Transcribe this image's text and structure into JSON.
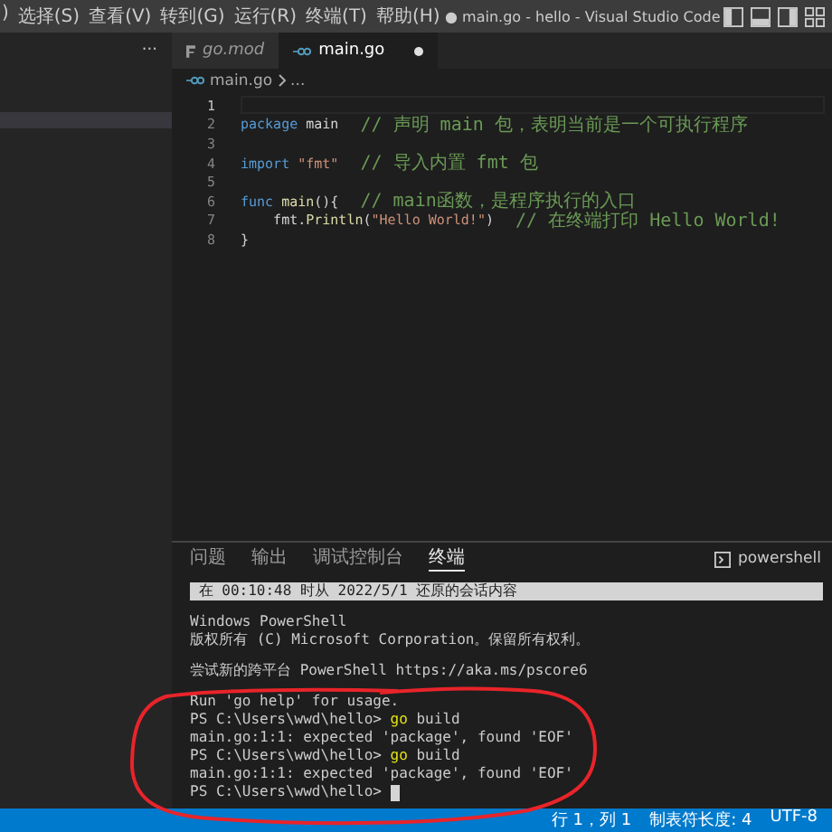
{
  "title_bar": {
    "menu": [
      ")",
      "选择(S)",
      "查看(V)",
      "转到(G)",
      "运行(R)",
      "终端(T)",
      "帮助(H)"
    ],
    "title": "● main.go - hello - Visual Studio Code"
  },
  "sidebar": {
    "more": "···"
  },
  "tabs": [
    {
      "label": "go.mod",
      "selected": false,
      "preview": true
    },
    {
      "label": "main.go",
      "selected": true,
      "preview": false,
      "modified": true
    }
  ],
  "breadcrumb": [
    "main.go",
    "..."
  ],
  "editor": {
    "lines": [
      {
        "number": "1",
        "current": true
      },
      {
        "number": "2",
        "current": false,
        "tokens": [
          {
            "kind": "keyword",
            "text": "package"
          },
          {
            "kind": "plain",
            "text": " main"
          },
          {
            "kind": "comment",
            "text": "  // 声明 main 包，表明当前是一个可执行程序"
          }
        ]
      },
      {
        "number": "3",
        "current": false
      },
      {
        "number": "4",
        "current": false,
        "tokens": [
          {
            "kind": "keyword",
            "text": "import "
          },
          {
            "kind": "string",
            "text": "\"fmt\""
          },
          {
            "kind": "comment",
            "text": "  // 导入内置 fmt 包"
          }
        ]
      },
      {
        "number": "5",
        "current": false
      },
      {
        "number": "6",
        "current": false,
        "tokens": [
          {
            "kind": "keyword",
            "text": "func "
          },
          {
            "kind": "function",
            "text": "main"
          },
          {
            "kind": "plain",
            "text": "(){"
          },
          {
            "kind": "comment",
            "text": "  // main函数，是程序执行的入口"
          }
        ]
      },
      {
        "number": "7",
        "current": false,
        "tokens": [
          {
            "kind": "plain",
            "text": "    fmt."
          },
          {
            "kind": "function",
            "text": "Println"
          },
          {
            "kind": "plain",
            "text": "("
          },
          {
            "kind": "string",
            "text": "\"Hello World!\""
          },
          {
            "kind": "plain",
            "text": ")"
          },
          {
            "kind": "comment",
            "text": "  // 在终端打印 Hello World!"
          }
        ]
      },
      {
        "number": "8",
        "current": false,
        "tokens": [
          {
            "kind": "plain",
            "text": "}"
          }
        ]
      }
    ]
  },
  "panel": {
    "tabs": [
      {
        "label": "问题",
        "selected": false
      },
      {
        "label": "输出",
        "selected": false
      },
      {
        "label": "调试控制台",
        "selected": false
      },
      {
        "label": "终端",
        "selected": true
      }
    ],
    "shell": "powershell",
    "terminal": [
      {
        "kind": "banner",
        "parts": [
          {
            "kind": "plain",
            "text": " 在 00:10:48 时从 2022/5/1 还原的会话内容"
          }
        ]
      },
      {
        "kind": "blank"
      },
      {
        "kind": "text",
        "parts": [
          {
            "kind": "plain",
            "text": "Windows PowerShell"
          }
        ]
      },
      {
        "kind": "text",
        "parts": [
          {
            "kind": "plain",
            "text": "版权所有 (C) Microsoft Corporation。保留所有权利。"
          }
        ]
      },
      {
        "kind": "blank"
      },
      {
        "kind": "text",
        "parts": [
          {
            "kind": "plain",
            "text": "尝试新的跨平台 PowerShell https://aka.ms/pscore6"
          }
        ]
      },
      {
        "kind": "blank"
      },
      {
        "kind": "text",
        "parts": [
          {
            "kind": "plain",
            "text": "Run 'go help' for usage."
          }
        ]
      },
      {
        "kind": "text",
        "parts": [
          {
            "kind": "plain",
            "text": "PS C:\\Users\\wwd\\hello> "
          },
          {
            "kind": "command",
            "text": "go"
          },
          {
            "kind": "plain",
            "text": " build"
          }
        ]
      },
      {
        "kind": "text",
        "parts": [
          {
            "kind": "plain",
            "text": "main.go:1:1: expected 'package', found 'EOF'"
          }
        ]
      },
      {
        "kind": "text",
        "parts": [
          {
            "kind": "plain",
            "text": "PS C:\\Users\\wwd\\hello> "
          },
          {
            "kind": "command",
            "text": "go"
          },
          {
            "kind": "plain",
            "text": " build"
          }
        ]
      },
      {
        "kind": "text",
        "parts": [
          {
            "kind": "plain",
            "text": "main.go:1:1: expected 'package', found 'EOF'"
          }
        ]
      },
      {
        "kind": "text",
        "cursor": true,
        "parts": [
          {
            "kind": "plain",
            "text": "PS C:\\Users\\wwd\\hello> "
          }
        ]
      }
    ]
  },
  "status_bar": {
    "items": [
      "行 1，列 1",
      "制表符长度: 4",
      "UTF-8"
    ]
  }
}
